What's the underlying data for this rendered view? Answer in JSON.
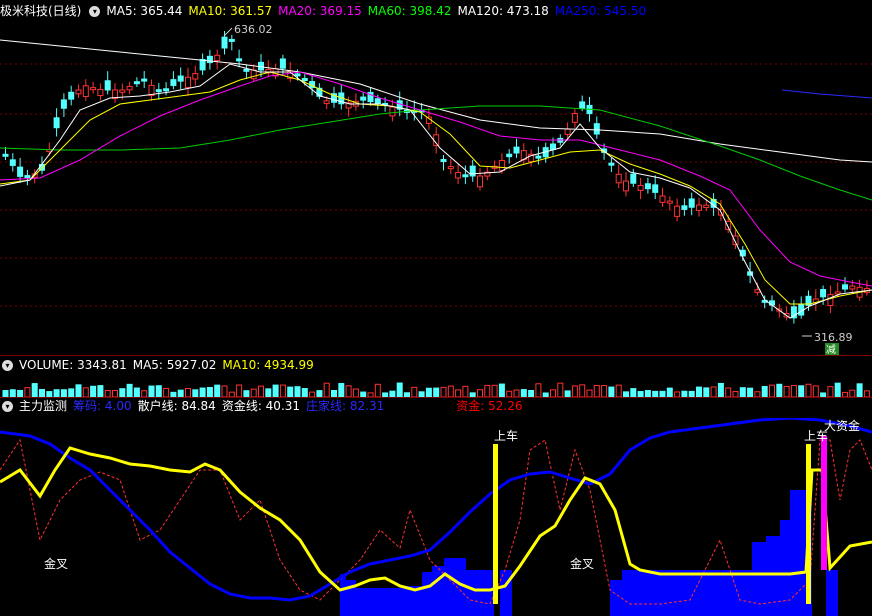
{
  "main_header": {
    "title": "极米科技(日线)",
    "ma5": {
      "label": "MA5: 365.44",
      "color": "#ffffff"
    },
    "ma10": {
      "label": "MA10: 361.57",
      "color": "#ffff00"
    },
    "ma20": {
      "label": "MA20: 369.15",
      "color": "#ff00ff"
    },
    "ma60": {
      "label": "MA60: 398.42",
      "color": "#00ff00"
    },
    "ma120": {
      "label": "MA120: 473.18",
      "color": "#ffffff"
    },
    "ma250": {
      "label": "MA250: 545.50",
      "color": "#0000ff"
    }
  },
  "price_annotations": {
    "high": "636.02",
    "low": "316.89",
    "low_tag": "减"
  },
  "volume_header": {
    "volume": {
      "label": "VOLUME: 3343.81",
      "color": "#ffffff"
    },
    "ma5": {
      "label": "MA5: 5927.02",
      "color": "#ffffff"
    },
    "ma10": {
      "label": "MA10: 4934.99",
      "color": "#ffff00"
    }
  },
  "indicator_header": {
    "name": "主力监测",
    "zhuchou": {
      "label": "筹码: 4.00",
      "color": "#0000ff"
    },
    "sanhu": {
      "label": "散户线: 84.84",
      "color": "#ffffff"
    },
    "zijinxian": {
      "label": "资金线: 40.31",
      "color": "#ffffff"
    },
    "zhuangjia": {
      "label": "庄家线: 82.31",
      "color": "#0000ff"
    },
    "zijin": {
      "label": "资金: 52.26",
      "color": "#ff0000"
    }
  },
  "indicator_annotations": {
    "shangche_1": "上车",
    "shangche_2": "上车",
    "dazijin": "大资金",
    "jincha_1": "金叉",
    "jincha_2": "金叉"
  },
  "colors": {
    "up": "#ff3232",
    "down": "#54ffff",
    "grid": "#7a0000",
    "background": "#000000"
  }
}
